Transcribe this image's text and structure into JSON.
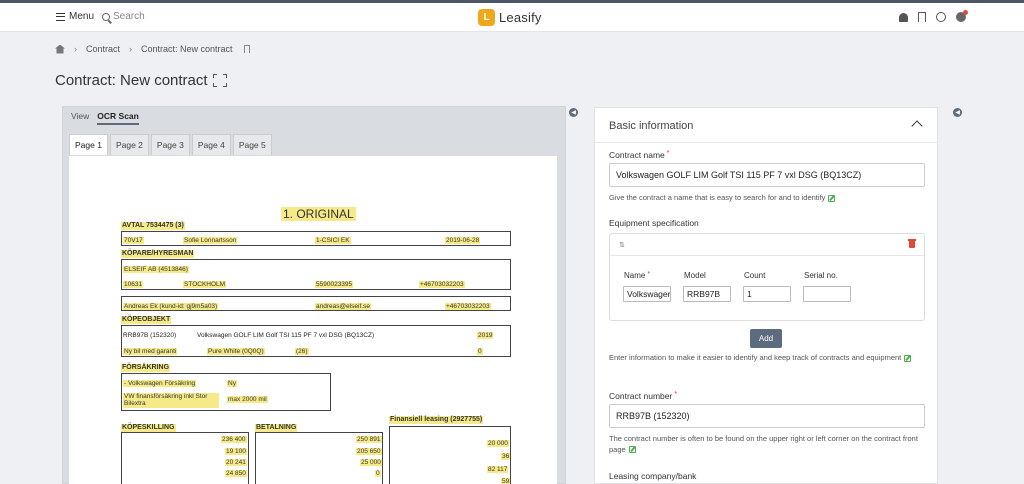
{
  "header": {
    "menu_label": "Menu",
    "search_label": "Search",
    "logo_text": "Leasify",
    "logo_letter": "L",
    "icons": [
      "bell-icon",
      "bookmark-icon",
      "globe-icon",
      "user-icon"
    ]
  },
  "breadcrumb": {
    "items": [
      "Contract",
      "Contract: New contract"
    ]
  },
  "page_title": "Contract: New contract",
  "left_panel": {
    "view_tabs": [
      "View",
      "OCR Scan"
    ],
    "active_view_tab": "OCR Scan",
    "page_tabs": [
      "Page 1",
      "Page 2",
      "Page 3",
      "Page 4",
      "Page 5"
    ],
    "active_page_tab": "Page 1"
  },
  "document": {
    "heading": "1. ORIGINAL",
    "avtal": "AVTAL 7534475 (3)",
    "avtal_number": "70V17",
    "seller_person": "Sofie Lonnartsson",
    "dealer_code": "1-CSICI EK",
    "contract_date": "2019-06-28",
    "buyer_heading": "KÖPARE/HYRESMAN",
    "buyer_name": "ELSEIF AB (4513846)",
    "postal_code": "10631",
    "city": "STOCKHOLM",
    "org_number": "5590023395",
    "phone": "+46703032203",
    "contact": "Andreas Ek (kund-id: gj9m5a03)",
    "email": "andreas@elseif.se",
    "phone2": "+46703032203",
    "object_heading": "KÖPEOBJEKT",
    "reg_number": "RRB97B (152320)",
    "vehicle": "Volkswagen GOLF LIM Golf TSI 115 PF 7 vxl DSG (BQ13CZ)",
    "model_year": "2019",
    "condition": "Ny bil med garanti",
    "color": "Pure White (0Q0Q)",
    "meter": "(26)",
    "mileage": "0",
    "insurance_heading": "FÖRSÄKRING",
    "insurer": "- Volkswagen Försäkring",
    "insurance_type": "Ny",
    "insurance_desc": "VW finansförsäkring inkl Stor Bilextra",
    "insurance_limit": "max 2000 mil",
    "financing_heading": "Finansiell leasing (2927755)",
    "purchase_heading": "KÖPESKILLING",
    "payment_heading": "BETALNING",
    "purchase_values": [
      "236 400",
      "19 100",
      "20 241",
      "24 850"
    ],
    "payment_values": [
      "250 891",
      "205 650",
      "25 000",
      "0"
    ],
    "financing_values": [
      "20 000",
      "36",
      "82 117",
      "59"
    ]
  },
  "form": {
    "section_title": "Basic information",
    "contract_name_label": "Contract name",
    "contract_name_value": "Volkswagen GOLF LIM Golf TSI 115 PF 7 vxl DSG (BQ13CZ)",
    "contract_name_help": "Give the contract a name that is easy to search for and to identify",
    "equipment_label": "Equipment specification",
    "equipment_columns": {
      "name": "Name",
      "model": "Model",
      "count": "Count",
      "serial": "Serial no."
    },
    "equipment_row": {
      "name": "Volkswagen",
      "model": "RRB97B",
      "count": "1",
      "serial": ""
    },
    "add_button": "Add",
    "equipment_help": "Enter information to make it easier to identify and keep track of contracts and equipment",
    "contract_number_label": "Contract number",
    "contract_number_value": "RRB97B (152320)",
    "contract_number_help": "The contract number is often to be found on the upper right or left corner on the contract front page",
    "leasing_company_label": "Leasing company/bank"
  }
}
